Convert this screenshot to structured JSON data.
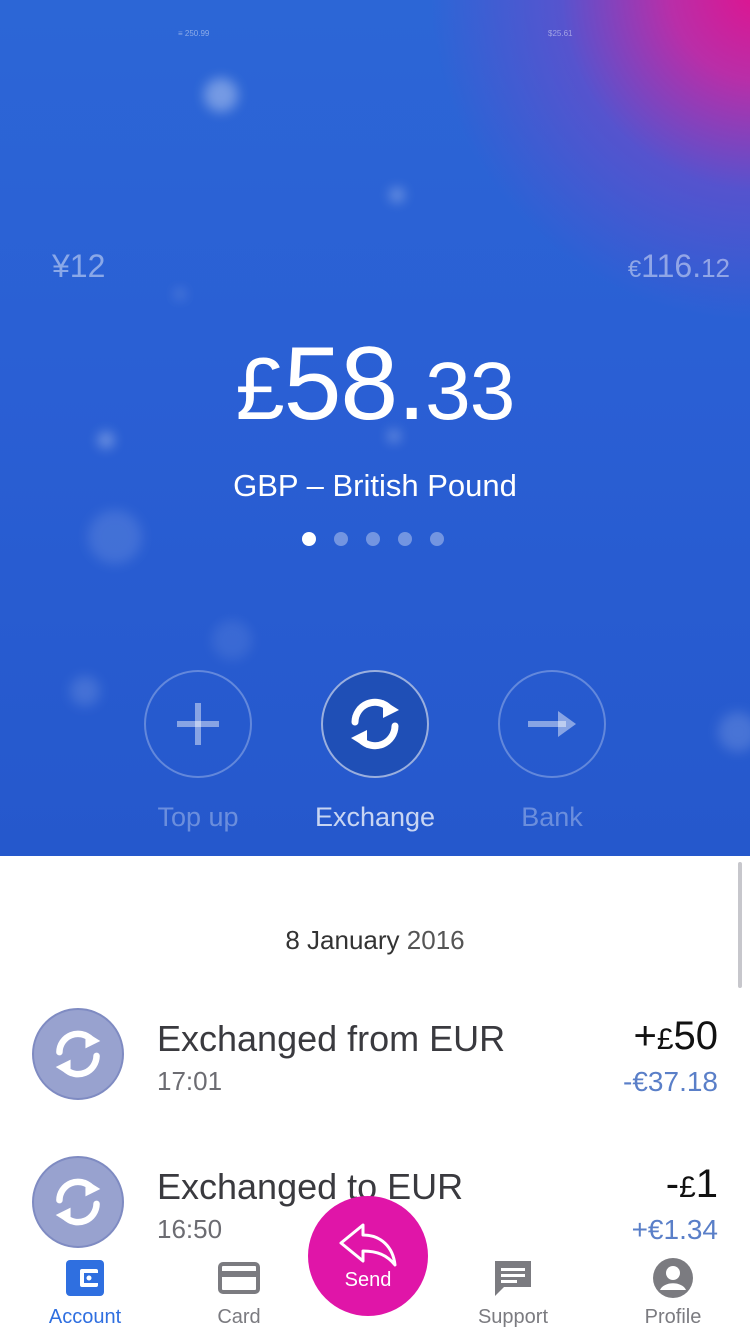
{
  "hero": {
    "tiny_left": "≡ 250.99",
    "tiny_right": "$25.61",
    "left_balance": "¥12",
    "right_balance_symbol": "€",
    "right_balance_int": "116.",
    "right_balance_dec": "12",
    "balance_symbol": "£",
    "balance_int": "58.",
    "balance_dec": "33",
    "currency_name": "GBP – British Pound",
    "page_dots": 5,
    "active_dot": 0
  },
  "actions": [
    {
      "label": "Top up",
      "icon": "plus-icon"
    },
    {
      "label": "Exchange",
      "icon": "exchange-icon"
    },
    {
      "label": "Bank",
      "icon": "arrow-right-icon"
    }
  ],
  "list": {
    "date_day": "8 January",
    "date_year": "2016",
    "transactions": [
      {
        "title": "Exchanged from EUR",
        "time": "17:01",
        "amount_sign": "+",
        "amount_symbol": "£",
        "amount_value": "50",
        "secondary": "-€37.18"
      },
      {
        "title": "Exchanged to EUR",
        "time": "16:50",
        "amount_sign": "-",
        "amount_symbol": "£",
        "amount_value": "1",
        "secondary": "+€1.34"
      }
    ]
  },
  "tabbar": {
    "account": "Account",
    "card": "Card",
    "send": "Send",
    "support": "Support",
    "profile": "Profile",
    "active": "account"
  },
  "colors": {
    "hero_blue": "#2a5fd4",
    "accent_pink": "#e015a8",
    "active_tab": "#2f6fe0",
    "secondary_amount": "#5a7fc8"
  }
}
